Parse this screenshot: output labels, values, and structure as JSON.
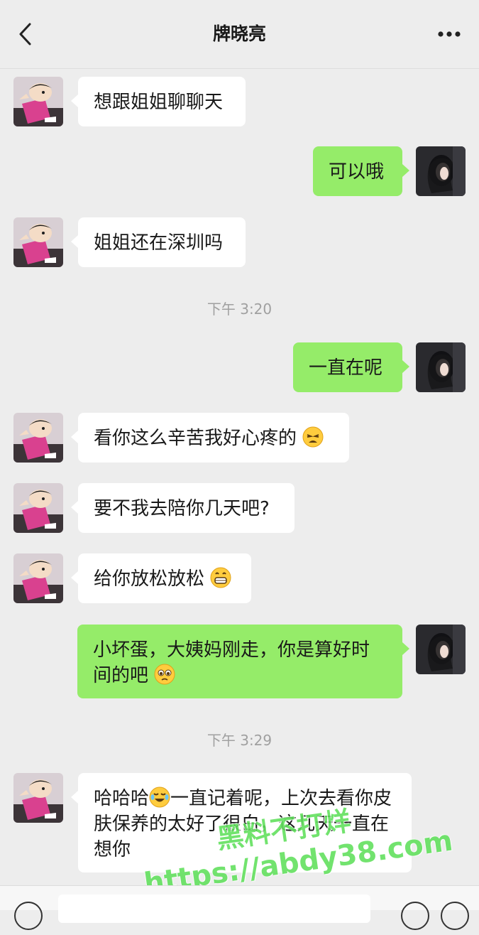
{
  "header": {
    "title": "牌晓亮",
    "back_icon": "chevron-left-icon",
    "more_icon": "more-dots-icon"
  },
  "messages": [
    {
      "side": "left",
      "text": "想跟姐姐聊聊天"
    },
    {
      "side": "right",
      "text": "可以哦"
    },
    {
      "side": "left",
      "text": "姐姐还在深圳吗"
    },
    {
      "time": "下午 3:20"
    },
    {
      "side": "right",
      "text": "一直在呢"
    },
    {
      "side": "left",
      "text": "看你这么辛苦我好心疼的",
      "emoji": "tired-face-emoji"
    },
    {
      "side": "left",
      "text": "要不我去陪你几天吧?"
    },
    {
      "side": "left",
      "text": "给你放松放松",
      "emoji": "grinning-face-emoji"
    },
    {
      "side": "right",
      "text": "小坏蛋，大姨妈刚走，你是算好时间的吧",
      "emoji": "pleading-face-emoji"
    },
    {
      "time": "下午 3:29"
    },
    {
      "side": "left",
      "text_before": "哈哈哈",
      "emoji": "rofl-face-emoji",
      "text_after": "一直记着呢，上次去看你皮肤保养的太好了很白，这几天一直在想你"
    }
  ],
  "watermark": {
    "line1": "黑料不打烊",
    "line2": "https://abdy38.com"
  },
  "colors": {
    "background": "#ededed",
    "self_bubble": "#95ec69",
    "other_bubble": "#ffffff",
    "timestamp": "#a0a0a0",
    "watermark": "#5fe05b"
  }
}
